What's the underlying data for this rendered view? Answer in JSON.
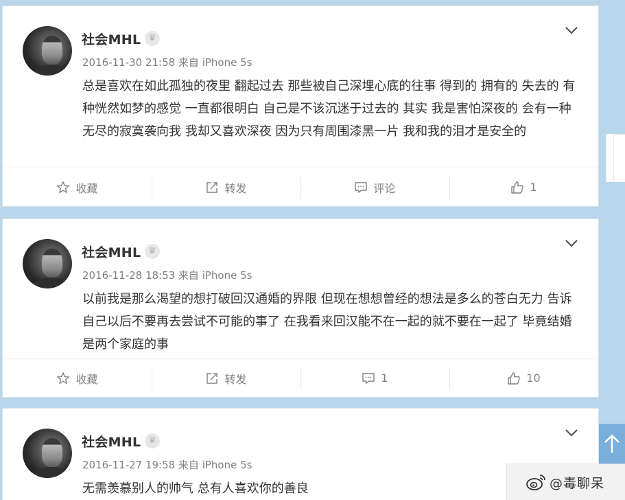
{
  "posts": [
    {
      "author": "社会MHL",
      "meta": "2016-11-30 21:58 来自 iPhone 5s",
      "text": "总是喜欢在如此孤独的夜里 翻起过去 那些被自己深埋心底的往事 得到的 拥有的 失去的 有种恍然如梦的感觉 一直都很明白 自己是不该沉迷于过去的 其实 我是害怕深夜的 会有一种无尽的寂寞袭向我 我却又喜欢深夜 因为只有周围漆黑一片 我和我的泪才是安全的",
      "actions": {
        "favorite": "收藏",
        "repost": "转发",
        "comment": "评论",
        "like": "1"
      }
    },
    {
      "author": "社会MHL",
      "meta": "2016-11-28 18:53 来自 iPhone 5s",
      "text": "以前我是那么渴望的想打破回汉通婚的界限 但现在想想曾经的想法是多么的苍白无力 告诉自己以后不要再去尝试不可能的事了 在我看来回汉能不在一起的就不要在一起了 毕竟结婚是两个家庭的事",
      "actions": {
        "favorite": "收藏",
        "repost": "转发",
        "comment": "1",
        "like": "10"
      }
    },
    {
      "author": "社会MHL",
      "meta": "2016-11-27 19:58 来自 iPhone 5s",
      "text": "无需羡慕别人的帅气 总有人喜欢你的善良",
      "actions": {
        "favorite": "",
        "repost": "",
        "comment": "",
        "like": ""
      }
    }
  ],
  "icons": {
    "member_badge": "crown-icon",
    "more": "chevron-down-icon",
    "favorite": "star-icon",
    "repost": "share-icon",
    "comment": "comment-icon",
    "like": "thumbs-up-icon",
    "back_to_top": "arrow-up-icon",
    "watermark_logo": "weibo-logo-icon"
  },
  "watermark": {
    "text": "@毒聊呆"
  },
  "colors": {
    "page_background": "#b9d6ea",
    "card": "#ffffff",
    "accent": "#7aaedb"
  }
}
